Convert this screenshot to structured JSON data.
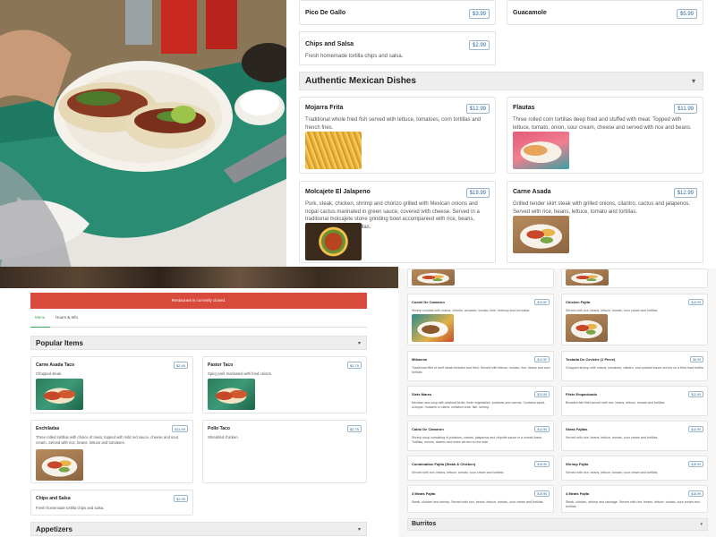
{
  "top_menu": {
    "cards_top": [
      {
        "title": "Pico De Gallo",
        "price": "$3.99",
        "desc": ""
      },
      {
        "title": "Guacamole",
        "price": "$5.99",
        "desc": ""
      },
      {
        "title": "Chips and Salsa",
        "price": "$2.99",
        "desc": "Fresh homemade tortilla chips and salsa."
      }
    ],
    "section_title": "Authentic Mexican Dishes",
    "section_chevron": "▾",
    "dishes": [
      {
        "title": "Mojarra Frita",
        "price": "$12.99",
        "desc": "Traditional whole fried fish served with lettuce, tomatoes, corn tortillas and french fries."
      },
      {
        "title": "Flautas",
        "price": "$11.99",
        "desc": "Three rolled corn tortillas deep fried and stuffed with meat. Topped with lettuce, tomato, onion, sour cream, cheese and served with rice and beans."
      },
      {
        "title": "Molcajete El Jalapeno",
        "price": "$19.99",
        "desc": "Pork, steak, chicken, shrimp and chorizo grilled with Mexican onions and nopal cactus marinated in green sauce, covered with cheese. Served in a traditional molcajete stone grinding bowl accompanied with rice, beans, lettuce, tomato and tortillas."
      },
      {
        "title": "Carne Asada",
        "price": "$12.99",
        "desc": "Grilled tender skirt steak with grilled onions, cilantro, cactus and jalapenos. Served with rice, beans, lettuce, tomato and tortillas."
      }
    ]
  },
  "left_menu": {
    "closed_notice": "Restaurant is currently closed.",
    "tabs": [
      "Menu",
      "Hours & Info"
    ],
    "popular_title": "Popular Items",
    "section_chevron": "▾",
    "items": [
      {
        "title": "Carne Asada Taco",
        "price": "$2.99",
        "desc": "Chopped steak."
      },
      {
        "title": "Pastor Taco",
        "price": "$2.75",
        "desc": "Spicy pork marinated with fried onions."
      },
      {
        "title": "Enchiladas",
        "price": "$11.99",
        "desc": "Three rolled tortillas with choice of meat, topped with mild red sauce, cheese and sour cream. Served with rice, beans, lettuce and tomatoes."
      },
      {
        "title": "Pollo Taco",
        "price": "$2.75",
        "desc": "Shredded chicken."
      },
      {
        "title": "Chips and Salsa",
        "price": "$2.99",
        "desc": "Fresh homemade tortilla chips and salsa."
      }
    ],
    "appetizers_title": "Appetizers"
  },
  "right_menu": {
    "left_col": [
      {
        "title": "Coctel De Camaron",
        "price": "$13.99",
        "desc": "Shrimp cocktail with onions, cilantro, avocado, tomato, lime, ketchup and hot salsa."
      },
      {
        "title": "Milanesa",
        "price": "$12.99",
        "desc": "Traditional fillet of beef steak breaded and fried. Served with lettuce, tomato, rice, beans and corn tortillas."
      },
      {
        "title": "Siete Mares",
        "price": "$13.99",
        "desc": "Mexican sea soup with seafood broth, fresh vegetables, potatoes and carrots. Contains squid, octopus, mussels or clams, imitation crab, fish, shrimp."
      },
      {
        "title": "Caldo De Camaron",
        "price": "$13.99",
        "desc": "Shrimp soup consisting of potatoes, carrots, jalapenos and chipotle sauce in a tomato base. Tortillas, onions, cilantro and limes served on the side."
      },
      {
        "title": "Combination Fajita (Steak & Chicken)",
        "price": "$15.99",
        "desc": "Served with rice, beans, lettuce, tomato, sour cream and tortillas."
      },
      {
        "title": "3 Meats Fajita",
        "price": "$15.99",
        "desc": "Steak, chicken and shrimp. Served with rice, beans, lettuce, tomato, sour cream and tortillas."
      }
    ],
    "right_col": [
      {
        "title": "Chicken Fajita",
        "price": "$13.99",
        "desc": "Served with rice, beans, lettuce, tomato, sour cream and tortillas."
      },
      {
        "title": "Tostada De Ceviche (1 Piece)",
        "price": "$4.99",
        "desc": "Chopped shrimp with onions, tomatoes, cilantro, and cocktail sauce served on a fried hard tortilla."
      },
      {
        "title": "Filete Empanizado",
        "price": "$12.99",
        "desc": "Breaded fish fillet served with rice, beans, lettuce, tomato and tortillas."
      },
      {
        "title": "Steak Fajitas",
        "price": "$13.99",
        "desc": "Served with rice, beans, lettuce, tomato, sour cream and tortillas."
      },
      {
        "title": "Shrimp Fajita",
        "price": "$15.99",
        "desc": "Served with rice, beans, lettuce, tomato, sour cream and tortillas."
      },
      {
        "title": "4 Meats Fajita",
        "price": "$16.99",
        "desc": "Steak, chicken, shrimp and sausage. Served with rice, beans, lettuce, tomato, sour cream and tortillas."
      }
    ],
    "burritos_title": "Burritos",
    "section_chevron": "▾"
  },
  "colors": {
    "accent_red": "#d84a3c",
    "price_blue": "#2c6aa0",
    "active_tab_green": "#3aa757"
  },
  "icons": [
    "chevron-down-icon",
    "food-photo"
  ]
}
